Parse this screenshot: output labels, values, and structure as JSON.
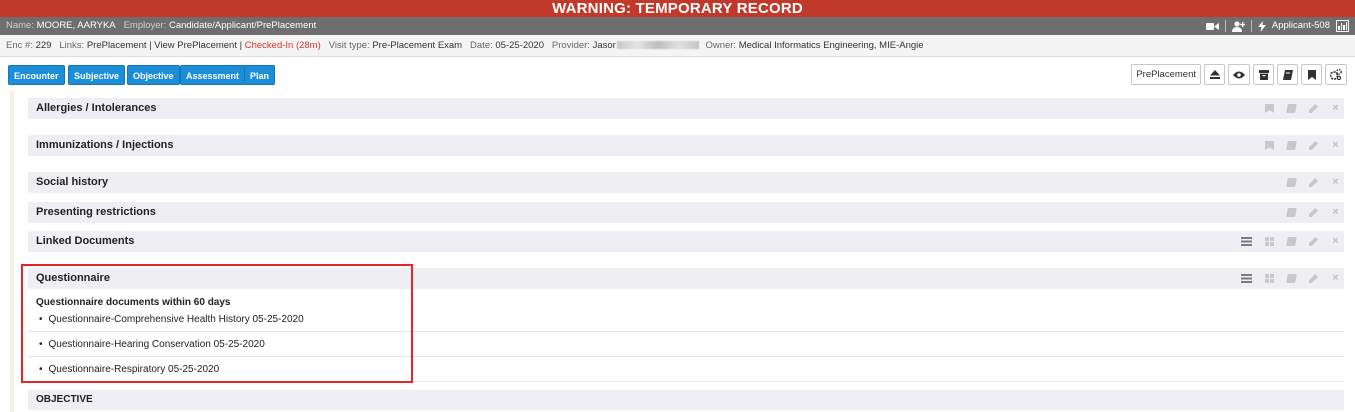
{
  "warning": "WARNING: TEMPORARY RECORD",
  "patient": {
    "name_label": "Name:",
    "name": "MOORE, AARYKA",
    "employer_label": "Employer:",
    "employer": "Candidate/Applicant/PrePlacement",
    "user": "Applicant-508"
  },
  "encounter": {
    "enc_label": "Enc #:",
    "enc_num": "229",
    "links_label": "Links:",
    "link1": "PrePlacement",
    "link_sep": "|",
    "link2": "View PrePlacement",
    "status": "Checked-In (28m)",
    "visit_label": "Visit type:",
    "visit": "Pre-Placement Exam",
    "date_label": "Date:",
    "date": "05-25-2020",
    "provider_label": "Provider:",
    "provider": "Jasor",
    "owner_label": "Owner:",
    "owner": "Medical Informatics Engineering, MIE-Angie"
  },
  "tabs": [
    "Encounter",
    "Subjective",
    "Objective",
    "Assessment",
    "Plan"
  ],
  "toolbar": {
    "preplacement_label": "PrePlacement"
  },
  "sections": {
    "allergies": "Allergies / Intolerances",
    "immunizations": "Immunizations / Injections",
    "social": "Social history",
    "restrictions": "Presenting restrictions",
    "linked": "Linked Documents",
    "questionnaire": "Questionnaire",
    "objective": "OBJECTIVE"
  },
  "questionnaire": {
    "subtitle": "Questionnaire documents within 60 days",
    "bullet": "•",
    "items": [
      "Questionnaire-Comprehensive Health History 05-25-2020",
      "Questionnaire-Hearing Conservation 05-25-2020",
      "Questionnaire-Respiratory 05-25-2020"
    ]
  },
  "colors": {
    "warning_bg": "#c0392b",
    "tab_blue": "#1c8ed8",
    "status_red": "#d9342b",
    "highlight": "#e8242a"
  },
  "icons": [
    "video-camera-icon",
    "add-user-icon",
    "lightning-icon",
    "bar-chart-icon",
    "eject-icon",
    "eye-icon",
    "archive-icon",
    "book-icon",
    "bookmark-icon",
    "gears-icon",
    "pencil-icon",
    "close-icon",
    "list-icon",
    "grid-icon"
  ]
}
